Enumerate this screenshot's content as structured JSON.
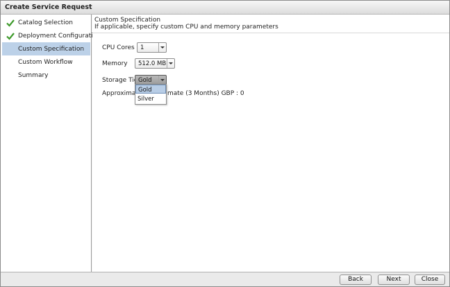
{
  "window": {
    "title": "Create Service Request"
  },
  "sidebar": {
    "steps": [
      {
        "label": "Catalog Selection",
        "completed": true
      },
      {
        "label": "Deployment Configuration",
        "completed": true
      },
      {
        "label": "Custom Specification",
        "completed": false,
        "active": true
      },
      {
        "label": "Custom Workflow",
        "completed": false
      },
      {
        "label": "Summary",
        "completed": false
      }
    ]
  },
  "main": {
    "title": "Custom Specification",
    "subtitle": "If applicable, specify custom CPU and memory parameters",
    "cpu": {
      "label": "CPU Cores",
      "value": "1"
    },
    "memory": {
      "label": "Memory",
      "value": "512.0 MB"
    },
    "storage": {
      "label": "Storage Tier",
      "value": "Gold",
      "options": [
        "Gold",
        "Silver"
      ],
      "highlighted": "Gold"
    },
    "estimate": {
      "label_left": "Approximate",
      "label_right": "mate  (3 Months) GBP  :  0"
    }
  },
  "footer": {
    "back": "Back",
    "next": "Next",
    "close": "Close"
  },
  "colors": {
    "active_step": "#bcd1e8",
    "check": "#3d9a2a",
    "highlight": "#b8cde6"
  }
}
